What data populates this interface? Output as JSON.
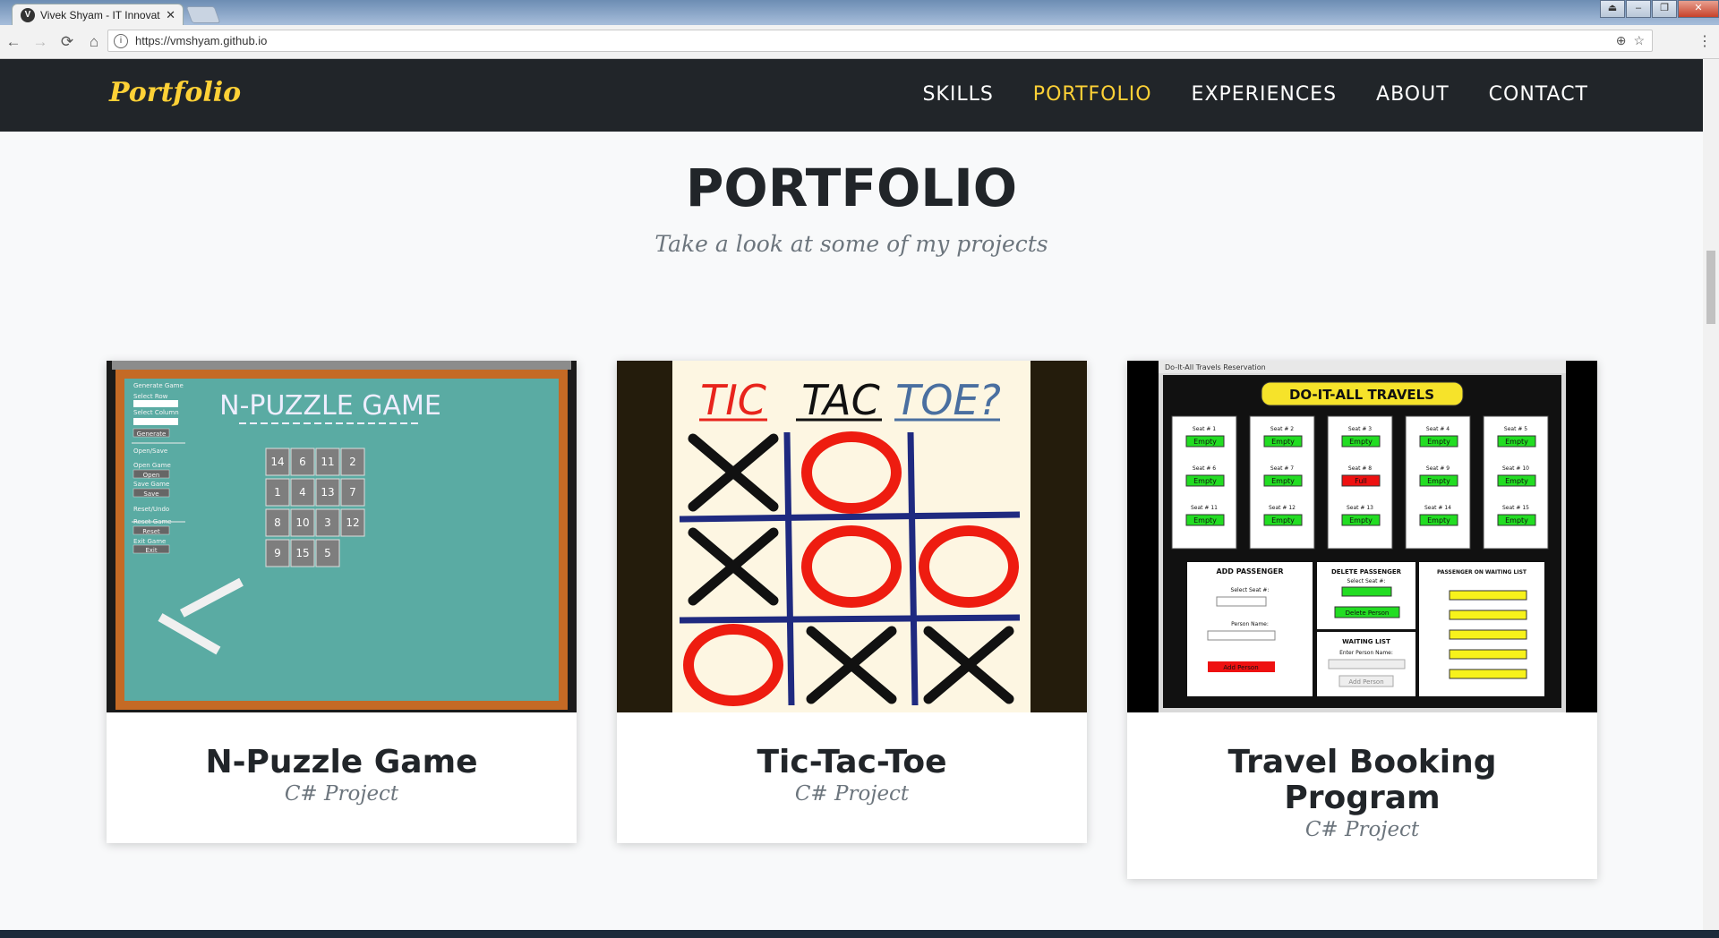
{
  "browser": {
    "tab_title": "Vivek Shyam - IT Innovat",
    "favicon_letter": "V",
    "tab_close": "✕",
    "url": "https://vmshyam.github.io"
  },
  "nav": {
    "brand": "Portfolio",
    "links": [
      "SKILLS",
      "PORTFOLIO",
      "EXPERIENCES",
      "ABOUT",
      "CONTACT"
    ],
    "active": "PORTFOLIO",
    "accent_color": "#fed136"
  },
  "section": {
    "heading": "PORTFOLIO",
    "subheading": "Take a look at some of my projects"
  },
  "projects": [
    {
      "title": "N-Puzzle Game",
      "subtitle": "C# Project",
      "thumbnail": {
        "banner": "N-PUZZLE GAME",
        "tiles": [
          "14",
          "6",
          "11",
          "2",
          "1",
          "4",
          "13",
          "7",
          "8",
          "10",
          "3",
          "12",
          "9",
          "15",
          "5"
        ],
        "menu_labels": [
          "Generate Game",
          "Select Row",
          "Select Column",
          "Generate",
          "Open/Save",
          "Open Game",
          "Open",
          "Save Game",
          "Save",
          "Reset/Undo",
          "Reset Game",
          "Reset",
          "Exit Game",
          "Exit"
        ]
      }
    },
    {
      "title": "Tic-Tac-Toe",
      "subtitle": "C# Project",
      "thumbnail": {
        "heading_words": [
          "TIC",
          "TAC",
          "TOE?"
        ],
        "board": [
          "X",
          "O",
          "",
          "X",
          "O",
          "O",
          "O",
          "X",
          "X"
        ]
      }
    },
    {
      "title": "Travel Booking Program",
      "subtitle": "C# Project",
      "thumbnail": {
        "window_title": "Do-It-All Travels Reservation",
        "banner": "DO-IT-ALL TRAVELS",
        "seat_states": [
          "Empty",
          "Empty",
          "Empty",
          "Empty",
          "Empty",
          "Empty",
          "Empty",
          "Full",
          "Empty",
          "Empty",
          "Empty",
          "Empty",
          "Empty",
          "Empty",
          "Empty"
        ],
        "panels": {
          "add": "ADD PASSENGER",
          "select_seat": "Select Seat #:",
          "person_name": "Person Name:",
          "add_button": "Add Person",
          "delete": "DELETE PASSENGER",
          "delete_select": "Select Seat #:",
          "delete_button": "Delete Person",
          "waiting": "WAITING LIST",
          "waiting_name": "Enter Person Name:",
          "waiting_button": "Add Person",
          "waiting_list": "PASSENGER ON WAITING LIST"
        }
      }
    }
  ]
}
